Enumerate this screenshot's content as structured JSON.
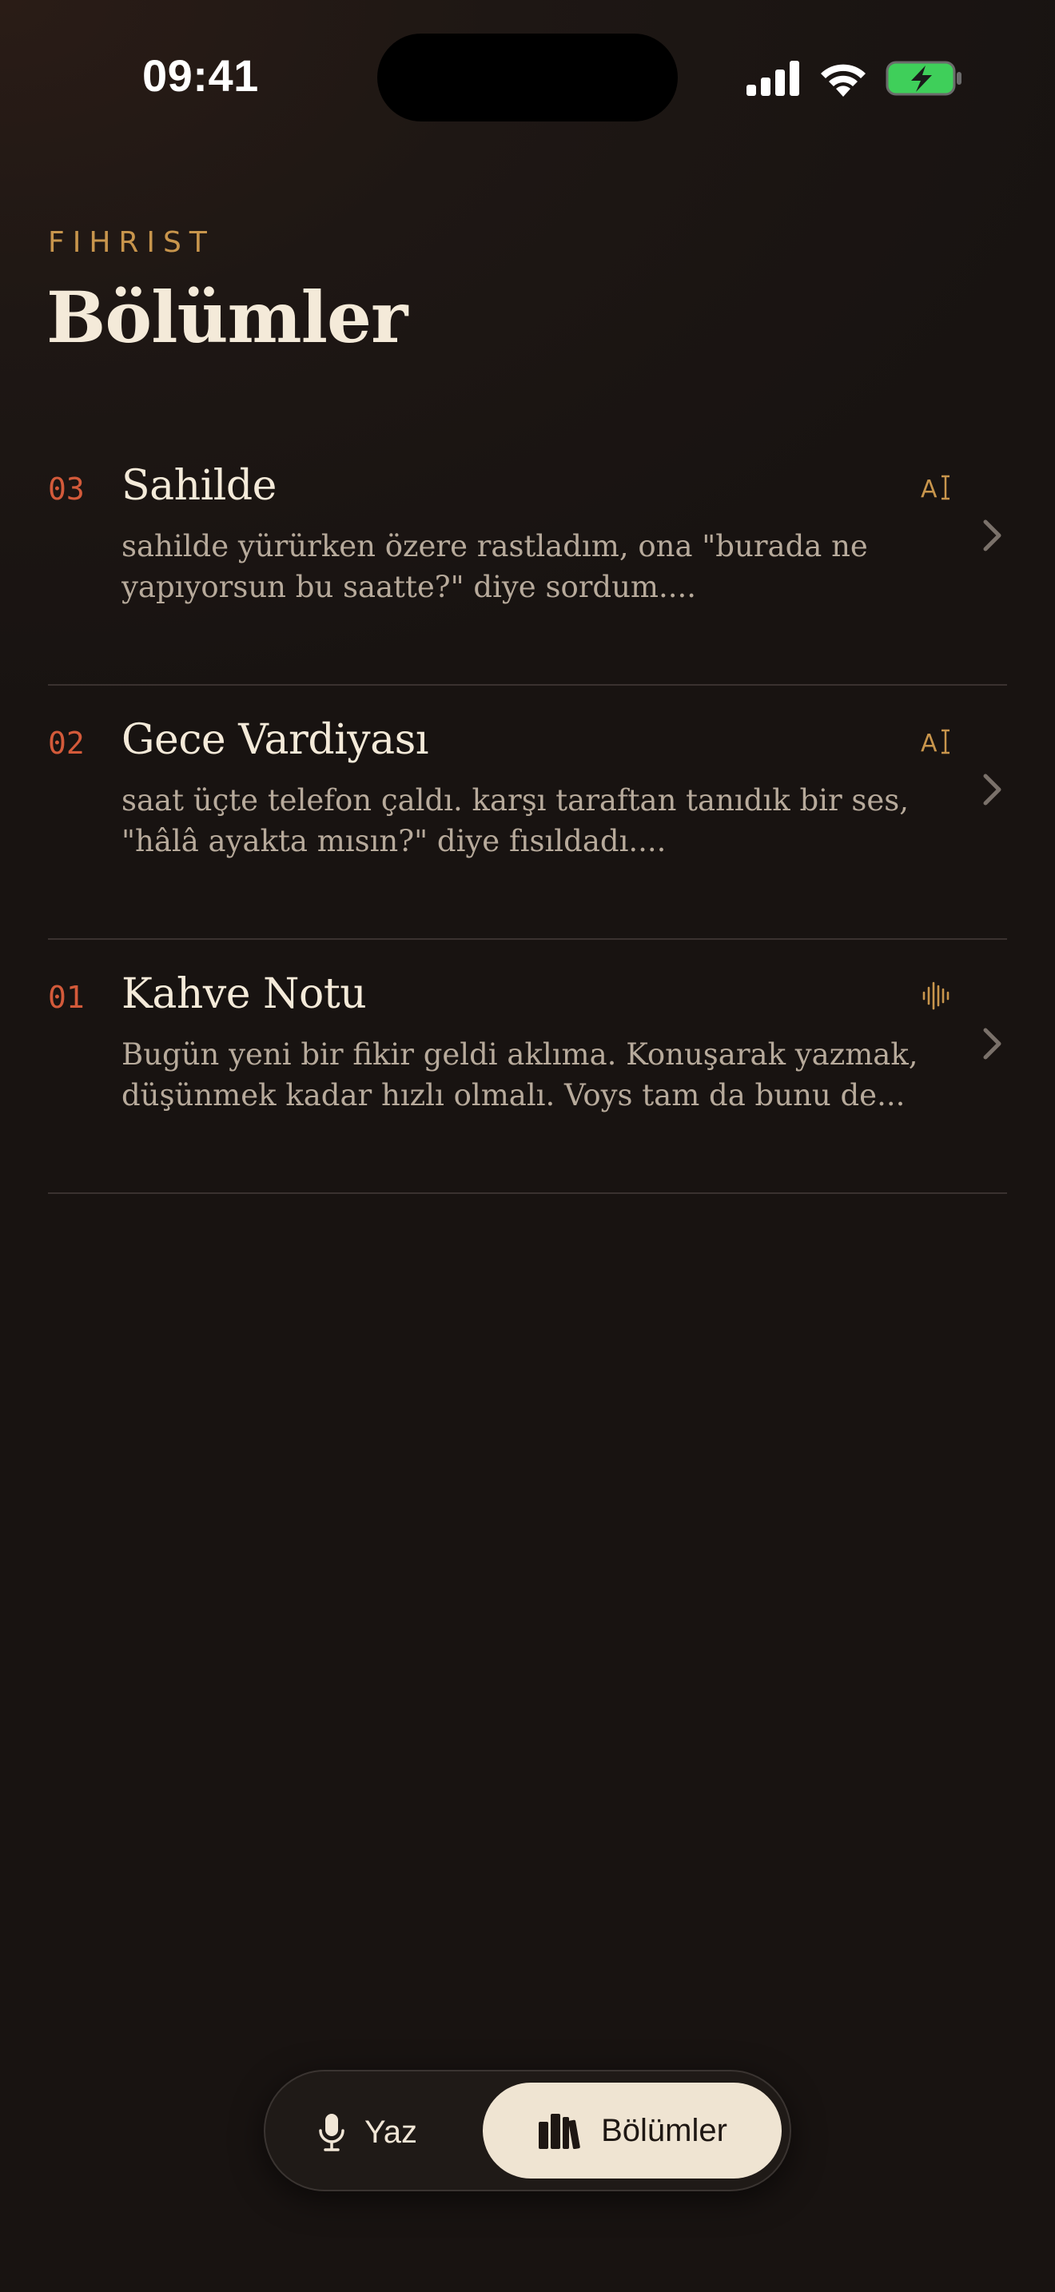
{
  "status_bar": {
    "time": "09:41",
    "icons": [
      "cellular-signal-icon",
      "wifi-icon",
      "battery-charging-icon"
    ],
    "battery_color": "#3fcf5a"
  },
  "header": {
    "eyebrow": "FIHRIST",
    "title": "Bölümler"
  },
  "chapters": [
    {
      "number": "03",
      "title": "Sahilde",
      "excerpt": "sahilde yürürken özere rastladım, ona \"burada ne yapıyorsun bu saatte?\" diye sordum....",
      "type_icon": "text-cursor-icon"
    },
    {
      "number": "02",
      "title": "Gece Vardiyası",
      "excerpt": "saat üçte telefon çaldı. karşı taraftan tanıdık bir ses, \"hâlâ ayakta mısın?\" diye fısıldadı....",
      "type_icon": "text-cursor-icon"
    },
    {
      "number": "01",
      "title": "Kahve Notu",
      "excerpt": "Bugün yeni bir fikir geldi aklıma. Konuşarak yazmak, düşünmek kadar hızlı olmalı. Voys tam da bunu de...",
      "type_icon": "waveform-icon"
    }
  ],
  "tab_bar": {
    "write_label": "Yaz",
    "chapters_label": "Bölümler",
    "active_tab": "Bölümler"
  },
  "colors": {
    "accent_number": "#d35a3a",
    "accent_gold": "#c8954c",
    "active_tab_bg": "#efe4d2"
  }
}
